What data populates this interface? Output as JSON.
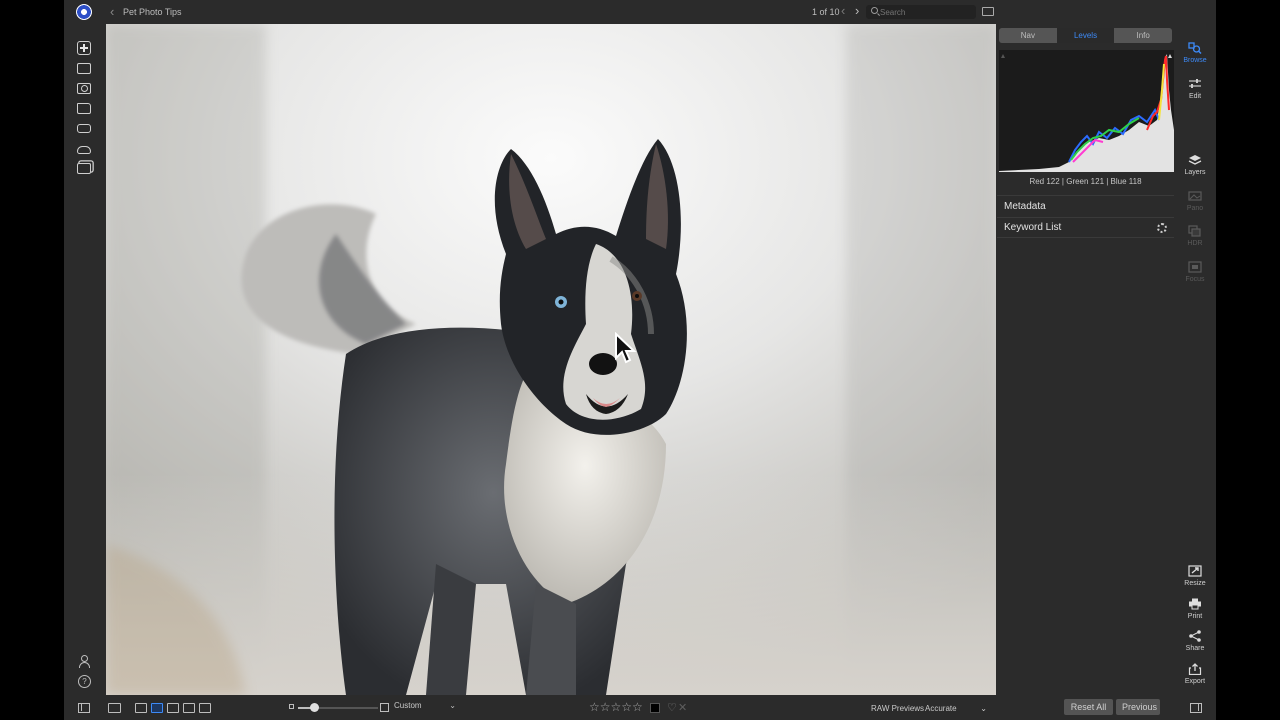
{
  "topbar": {
    "breadcrumb": "Pet Photo Tips",
    "counter": "1 of 10",
    "search_placeholder": "Search"
  },
  "right_panel": {
    "tabs": [
      {
        "label": "Nav",
        "active": false
      },
      {
        "label": "Levels",
        "active": true
      },
      {
        "label": "Info",
        "active": false
      }
    ],
    "histogram_readout": "Red 122 | Green 121 | Blue 118",
    "sections": [
      "Metadata",
      "Keyword List"
    ]
  },
  "modules_top": [
    {
      "label": "Browse",
      "icon": "browse-icon",
      "state": "active"
    },
    {
      "label": "Edit",
      "icon": "sliders-icon",
      "state": "normal"
    },
    {
      "label": "Layers",
      "icon": "layers-icon",
      "state": "normal"
    },
    {
      "label": "Pano",
      "icon": "pano-icon",
      "state": "disabled"
    },
    {
      "label": "HDR",
      "icon": "hdr-icon",
      "state": "disabled"
    },
    {
      "label": "Focus",
      "icon": "focus-icon",
      "state": "disabled"
    }
  ],
  "modules_bottom": [
    {
      "label": "Resize",
      "icon": "resize-icon"
    },
    {
      "label": "Print",
      "icon": "print-icon"
    },
    {
      "label": "Share",
      "icon": "share-icon"
    },
    {
      "label": "Export",
      "icon": "export-icon"
    }
  ],
  "bottombar": {
    "zoom_fraction": 0.2,
    "crop_preset": "Custom",
    "rating_stars": "☆☆☆☆☆",
    "rating": 0,
    "raw_previews_label": "RAW Previews",
    "raw_previews_value": "Accurate",
    "reset_all_label": "Reset All",
    "previous_label": "Previous"
  },
  "colors": {
    "accent": "#3d8af7",
    "panel_bg": "#2b2b2b",
    "button_bg": "#545454"
  }
}
